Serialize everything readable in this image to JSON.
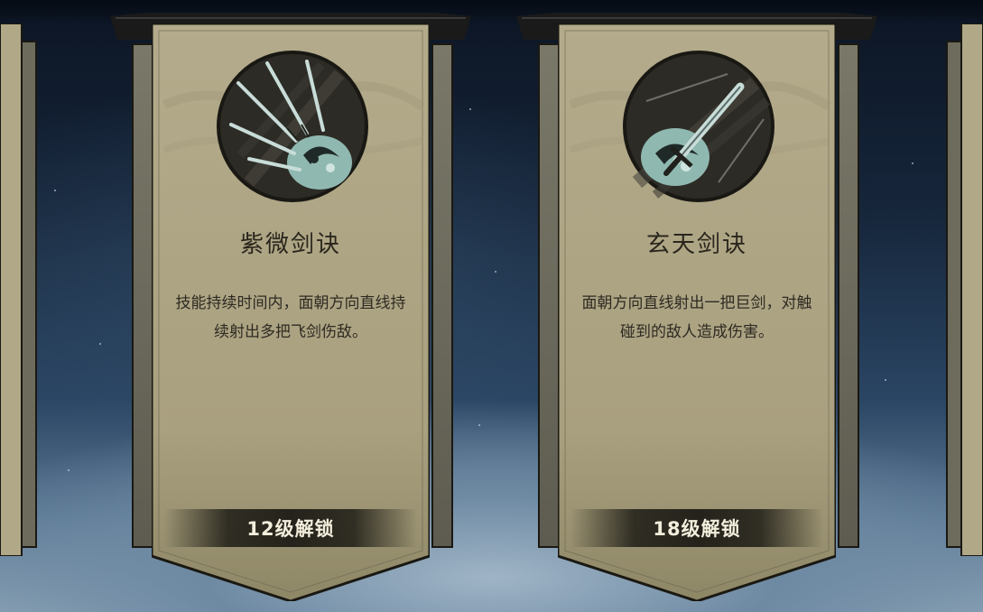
{
  "colors": {
    "parchment": "#b0a887",
    "parchment_dark": "#8e8766",
    "ink": "#2a261d",
    "unlock_text": "#f3eedc"
  },
  "skills": [
    {
      "name": "紫微剑诀",
      "description": "技能持续时间内，面朝方向直线持续射出多把飞剑伤敌。",
      "unlock": "12级解锁",
      "icon": "flying-swords-icon"
    },
    {
      "name": "玄天剑诀",
      "description": "面朝方向直线射出一把巨剑，对触碰到的敌人造成伤害。",
      "unlock": "18级解锁",
      "icon": "giant-sword-icon"
    }
  ]
}
